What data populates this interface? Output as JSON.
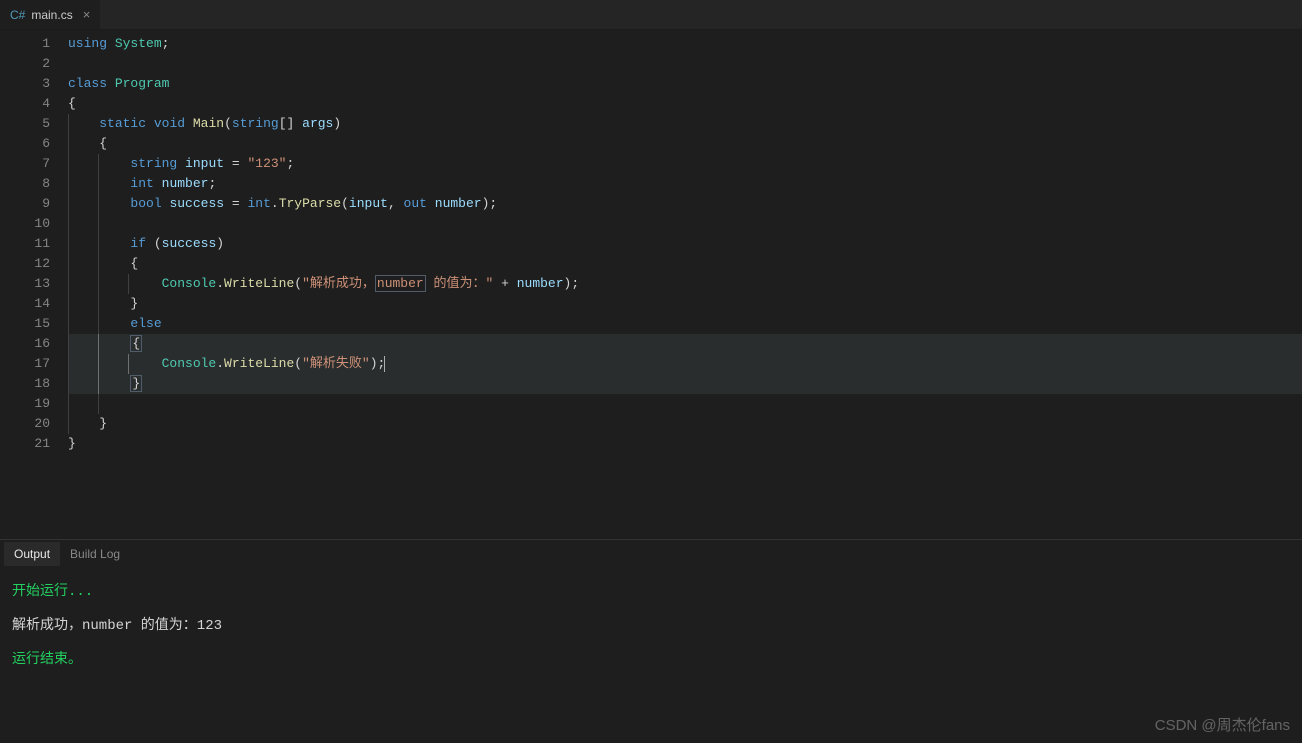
{
  "tab": {
    "icon": "C#",
    "filename": "main.cs",
    "close": "×"
  },
  "gutter": [
    "1",
    "2",
    "3",
    "4",
    "5",
    "6",
    "7",
    "8",
    "9",
    "10",
    "11",
    "12",
    "13",
    "14",
    "15",
    "16",
    "17",
    "18",
    "19",
    "20",
    "21"
  ],
  "code": {
    "l1": {
      "using": "using",
      "system": "System",
      "semi": ";"
    },
    "l3": {
      "class": "class",
      "program": "Program"
    },
    "l4": {
      "brace": "{"
    },
    "l5": {
      "static": "static",
      "void": "void",
      "main": "Main",
      "lp": "(",
      "string": "string",
      "br": "[]",
      "sp": " ",
      "args": "args",
      "rp": ")"
    },
    "l6": {
      "brace": "{"
    },
    "l7": {
      "string": "string",
      "input": "input",
      "eq": " = ",
      "val": "\"123\"",
      "semi": ";"
    },
    "l8": {
      "int": "int",
      "number": "number",
      "semi": ";"
    },
    "l9": {
      "bool": "bool",
      "success": "success",
      "eq": " = ",
      "intT": "int",
      "dot": ".",
      "try": "TryParse",
      "lp": "(",
      "input": "input",
      "cm": ", ",
      "out": "out",
      "sp": " ",
      "number": "number",
      "rp": ")",
      "semi": ";"
    },
    "l11": {
      "if": "if",
      "sp": " (",
      "success": "success",
      "rp": ")"
    },
    "l12": {
      "brace": "{"
    },
    "l13": {
      "console": "Console",
      "dot": ".",
      "wl": "WriteLine",
      "lp": "(",
      "s1": "\"解析成功，",
      "nbox": "number",
      "s2": " 的值为：\"",
      "plus": " + ",
      "number": "number",
      "rp": ")",
      "semi": ";"
    },
    "l14": {
      "brace": "}"
    },
    "l15": {
      "else": "else"
    },
    "l16": {
      "brace": "{"
    },
    "l17": {
      "console": "Console",
      "dot": ".",
      "wl": "WriteLine",
      "lp": "(",
      "s1": "\"解析失败\"",
      "rp": ")",
      "semi": ";"
    },
    "l18": {
      "brace": "}"
    },
    "l20": {
      "brace": "}"
    },
    "l21": {
      "brace": "}"
    }
  },
  "panel": {
    "tabs": {
      "output": "Output",
      "build": "Build Log"
    },
    "lines": {
      "start": "开始运行...",
      "result": "解析成功，number 的值为：123",
      "end": "运行结束。"
    }
  },
  "watermark": "CSDN @周杰伦fans"
}
